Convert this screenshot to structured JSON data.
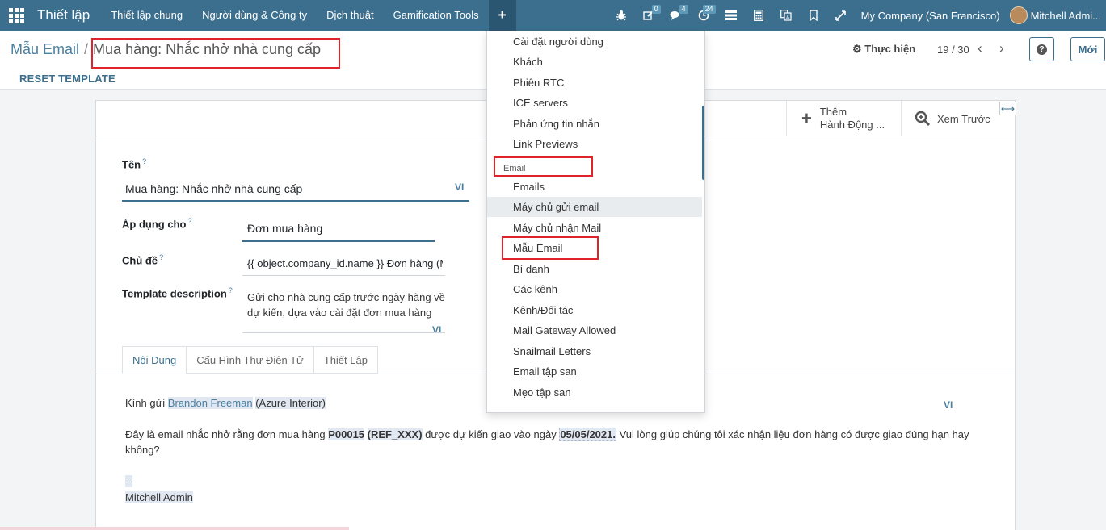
{
  "navbar": {
    "brand": "Thiết lập",
    "menu": [
      "Thiết lập chung",
      "Người dùng & Công ty",
      "Dịch thuật",
      "Gamification Tools"
    ],
    "plus": "+",
    "activities_badge": "0",
    "messages_badge": "4",
    "clock_badge": "24",
    "company": "My Company (San Francisco)",
    "user": "Mitchell Admi..."
  },
  "control": {
    "breadcrumb_parent": "Mẫu Email",
    "breadcrumb_sep": "/",
    "breadcrumb_current": "Mua hàng: Nhắc nhở nhà cung cấp",
    "action_label": "Thực hiện",
    "pager": "19 / 30",
    "help_symbol": "?",
    "new_label": "Mới",
    "reset_label": "RESET TEMPLATE"
  },
  "sheet": {
    "add_action_line1": "Thêm",
    "add_action_line2": "Hành Động ...",
    "preview_label": "Xem Trước",
    "expand_symbol": "⟷",
    "name_label": "Tên",
    "name_value": "Mua hàng: Nhắc nhở nhà cung cấp",
    "lang_code": "VI",
    "apply_label": "Áp dụng cho",
    "apply_value": "Đơn mua hàng",
    "subject_label": "Chủ đề",
    "subject_value": "{{ object.company_id.name }} Đơn hàng (M",
    "desc_label": "Template description",
    "desc_line1": "Gửi cho nhà cung cấp trước ngày hàng về",
    "desc_line2": "dự kiến, dựa vào cài đặt đơn mua hàng",
    "help_mark": "?"
  },
  "tabs": [
    "Nội Dung",
    "Cấu Hình Thư Điện Tử",
    "Thiết Lập"
  ],
  "content": {
    "greeting_prefix": "Kính gửi ",
    "partner_name": "Brandon Freeman",
    "company_name": "(Azure Interior)",
    "line2_a": "Đây là email nhắc nhở rằng đơn mua hàng ",
    "po_number": "P00015",
    "ref": "(REF_XXX)",
    "line2_b": " được dự kiến giao vào ngày ",
    "date": "05/05/2021.",
    "line2_c": " Vui lòng giúp chúng tôi xác nhận liệu đơn hàng có được giao đúng hạn hay",
    "line2_d": "không?",
    "sig_dashes": "--",
    "signature": "Mitchell Admin",
    "lang_code": "VI"
  },
  "dropdown": {
    "items_top": [
      "Cài đặt người dùng",
      "Khách",
      "Phiên RTC",
      "ICE servers",
      "Phản ứng tin nhắn",
      "Link Previews"
    ],
    "section": "Email",
    "items_bottom": [
      "Emails",
      "Máy chủ gửi email",
      "Máy chủ nhận Mail",
      "Mẫu Email",
      "Bí danh",
      "Các kênh",
      "Kênh/Đối tác",
      "Mail Gateway Allowed",
      "Snailmail Letters",
      "Email tập san",
      "Mẹo tập san"
    ]
  }
}
